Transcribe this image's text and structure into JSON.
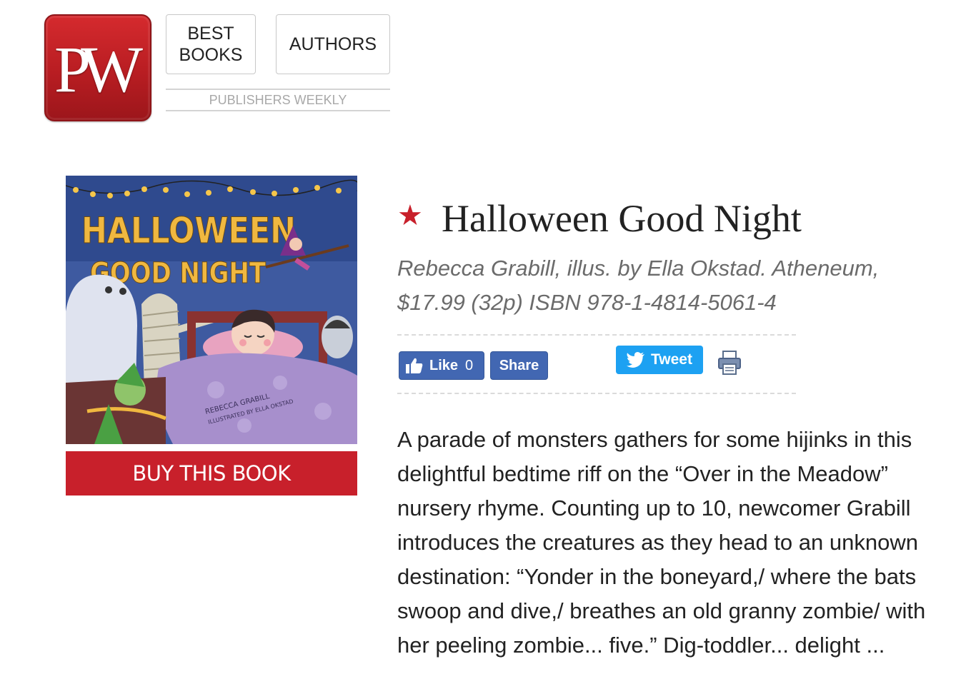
{
  "header": {
    "logo_text": "PW",
    "nav": {
      "best_books": "BEST\nBOOKS",
      "authors": "AUTHORS"
    },
    "tagline": "PUBLISHERS WEEKLY"
  },
  "book": {
    "cover": {
      "title_line1": "HALLOWEEN",
      "title_line2": "GOOD NIGHT",
      "author_credit": "REBECCA GRABILL",
      "illustrator_credit": "ILLUSTRATED BY ELLA OKSTAD",
      "colors": {
        "background": "#3e5aa0",
        "title": "#f0b840",
        "blanket": "#a78fcc",
        "bed": "#8a3230"
      }
    },
    "buy_label": "BUY THIS BOOK"
  },
  "review": {
    "starred": true,
    "star_glyph": "★",
    "title": "Halloween Good Night",
    "biblio": "Rebecca Grabill, illus. by Ella Okstad. Atheneum, $17.99 (32p) ISBN 978-1-4814-5061-4",
    "social": {
      "like_label": "Like",
      "like_count": "0",
      "share_label": "Share",
      "tweet_label": "Tweet",
      "print_icon": "printer-icon"
    },
    "body": "A parade of monsters gathers for some hijinks in this delightful bedtime riff on the “Over in the Meadow” nursery rhyme. Counting up to 10, newcomer Grabill introduces the creatures as they head to an unknown destination: “Yonder in the boneyard,/ where the bats swoop and dive,/ breathes an old granny zombie/ with her peeling zombie... five.” Dig-toddler... delight ..."
  },
  "colors": {
    "brand_red": "#c8202b",
    "facebook_blue": "#4267b2",
    "twitter_blue": "#1da1f2"
  }
}
